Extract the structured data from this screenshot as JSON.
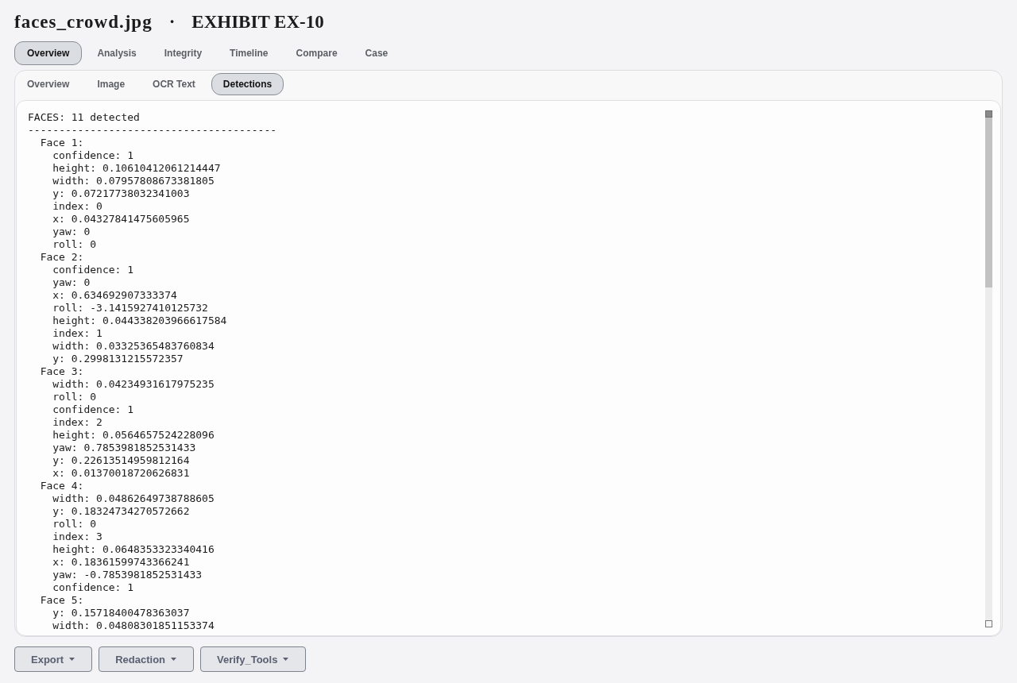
{
  "title": {
    "filename": "faces_crowd.jpg",
    "separator": "·",
    "exhibit": "EXHIBIT EX-10"
  },
  "tabs": [
    {
      "label": "Overview",
      "selected": true
    },
    {
      "label": "Analysis",
      "selected": false
    },
    {
      "label": "Integrity",
      "selected": false
    },
    {
      "label": "Timeline",
      "selected": false
    },
    {
      "label": "Compare",
      "selected": false
    },
    {
      "label": "Case",
      "selected": false
    }
  ],
  "panel": {
    "subtabs": [
      {
        "label": "Overview",
        "selected": false
      },
      {
        "label": "Image",
        "selected": false
      },
      {
        "label": "OCR Text",
        "selected": false
      },
      {
        "label": "Detections",
        "selected": true
      }
    ],
    "detections": {
      "heading": "FACES: 11 detected",
      "rule": "----------------------------------------",
      "faces": [
        {
          "label": "Face 1:",
          "children": [
            "confidence: 1",
            "height: 0.10610412061214447",
            "width: 0.07957808673381805",
            "y: 0.07217738032341003",
            "index: 0",
            "x: 0.04327841475605965",
            "yaw: 0",
            "roll: 0"
          ]
        },
        {
          "label": "Face 2:",
          "children": [
            "confidence: 1",
            "yaw: 0",
            "x: 0.634692907333374",
            "roll: -3.1415927410125732",
            "height: 0.044338203966617584",
            "index: 1",
            "width: 0.03325365483760834",
            "y: 0.2998131215572357"
          ]
        },
        {
          "label": "Face 3:",
          "children": [
            "width: 0.04234931617975235",
            "roll: 0",
            "confidence: 1",
            "index: 2",
            "height: 0.0564657524228096",
            "yaw: 0.7853981852531433",
            "y: 0.22613514959812164",
            "x: 0.01370018720626831"
          ]
        },
        {
          "label": "Face 4:",
          "children": [
            "width: 0.04862649738788605",
            "y: 0.18324734270572662",
            "roll: 0",
            "index: 3",
            "height: 0.0648353323340416",
            "x: 0.18361599743366241",
            "yaw: -0.7853981852531433",
            "confidence: 1"
          ]
        },
        {
          "label": "Face 5:",
          "children": [
            "y: 0.15718400478363037",
            "width: 0.04808301851153374"
          ]
        }
      ]
    }
  },
  "actions": [
    "Export",
    "Redaction",
    "Verify_Tools"
  ]
}
